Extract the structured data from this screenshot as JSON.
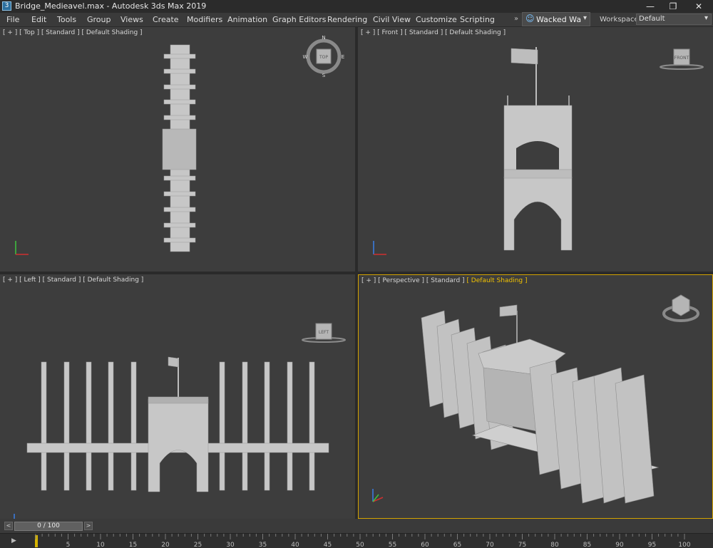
{
  "titlebar": {
    "icon": "3dsmax-app-icon",
    "title": "Bridge_Medieavel.max - Autodesk 3ds Max 2019",
    "minimize": "—",
    "restore": "❐",
    "close": "✕"
  },
  "menu": {
    "items": [
      "File",
      "Edit",
      "Tools",
      "Group",
      "Views",
      "Create",
      "Modifiers",
      "Animation",
      "Graph Editors",
      "Rendering",
      "Civil View",
      "Customize",
      "Scripting"
    ],
    "overflow": "»"
  },
  "user": {
    "icon": "user-icon",
    "name": "Wacked Wa",
    "dropdown": "▾"
  },
  "workspaces": {
    "label": "Workspaces:",
    "value": "Default",
    "dropdown": "▾"
  },
  "viewports": {
    "top": {
      "label": "[ + ] [ Top ] [ Standard ] [ Default Shading ]",
      "cube": "TOP",
      "compass": [
        "N",
        "E",
        "S",
        "W"
      ]
    },
    "front": {
      "label": "[ + ] [ Front ] [ Standard ] [ Default Shading ]",
      "cube": "FRONT"
    },
    "left": {
      "label": "[ + ] [ Left ] [ Standard ] [ Default Shading ]",
      "cube": "LEFT"
    },
    "perspective": {
      "label_main": "[ + ] [ Perspective ] [ Standard ] ",
      "label_shading": "[ Default Shading ]"
    }
  },
  "time": {
    "current": "0 / 100",
    "prev": "<",
    "next": ">",
    "ticks": [
      "0",
      "5",
      "10",
      "15",
      "20",
      "25",
      "30",
      "35",
      "40",
      "45",
      "50",
      "55",
      "60",
      "65",
      "70",
      "75",
      "80",
      "85",
      "90",
      "95",
      "100"
    ]
  },
  "colors": {
    "viewport_bg": "#3d3d3d",
    "geometry": "#c8c8c8",
    "active_border": "#d4a300",
    "axis_x": "#d03030",
    "axis_y": "#3ec43e",
    "axis_z": "#3a7ee8"
  }
}
